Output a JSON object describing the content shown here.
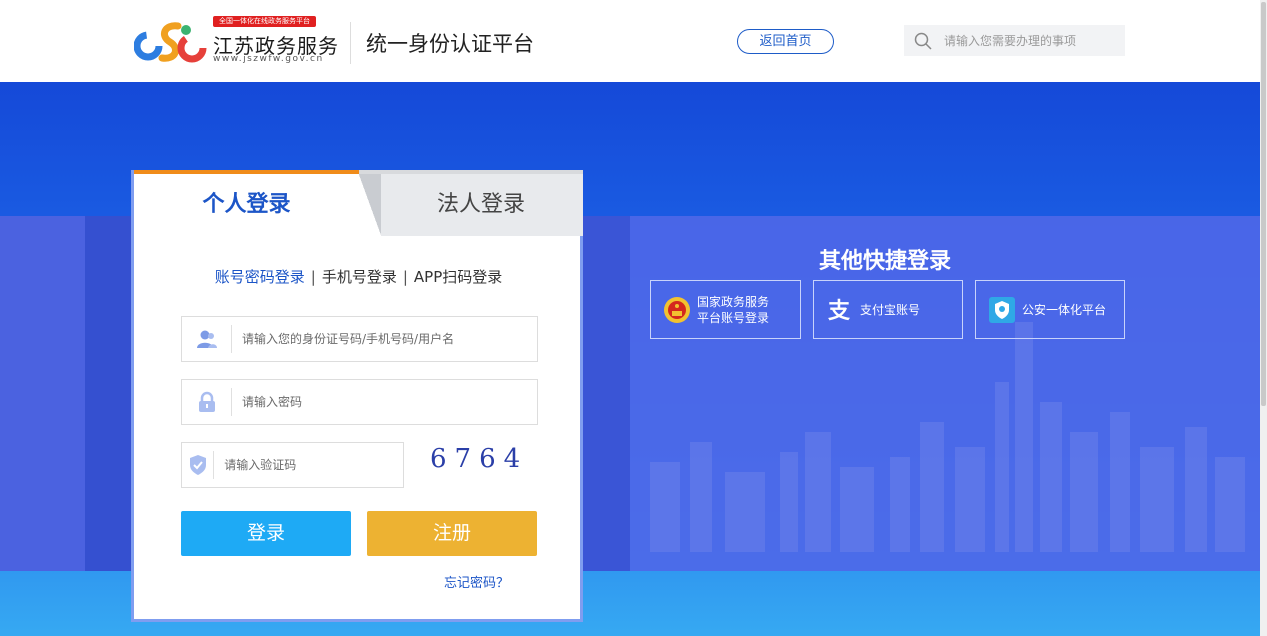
{
  "header": {
    "logo_badge": "全国一体化在线政务服务平台",
    "logo_name": "江苏政务服务",
    "logo_url": "www.jszwfw.gov.cn",
    "platform_title": "统一身份认证平台",
    "back_home": "返回首页",
    "search_placeholder": "请输入您需要办理的事项"
  },
  "login": {
    "tabs": [
      {
        "label": "个人登录",
        "active": true
      },
      {
        "label": "法人登录",
        "active": false
      }
    ],
    "modes": [
      "账号密码登录",
      "手机号登录",
      "APP扫码登录"
    ],
    "mode_separator": "|",
    "username_placeholder": "请输入您的身份证号码/手机号码/用户名",
    "password_placeholder": "请输入密码",
    "captcha_placeholder": "请输入验证码",
    "captcha_text": "6764",
    "login_button": "登录",
    "register_button": "注册",
    "forgot_password": "忘记密码？"
  },
  "quick_login": {
    "title": "其他快捷登录",
    "items": [
      {
        "line1": "国家政务服务",
        "line2": "平台账号登录",
        "icon": "national-emblem-icon"
      },
      {
        "label": "支付宝账号",
        "icon": "alipay-icon"
      },
      {
        "label": "公安一体化平台",
        "icon": "police-shield-icon"
      }
    ]
  },
  "colors": {
    "brand_blue": "#1c55c7",
    "active_tab_border": "#f08c1a",
    "login_button": "#1eaaf5",
    "register_button": "#edb232"
  }
}
